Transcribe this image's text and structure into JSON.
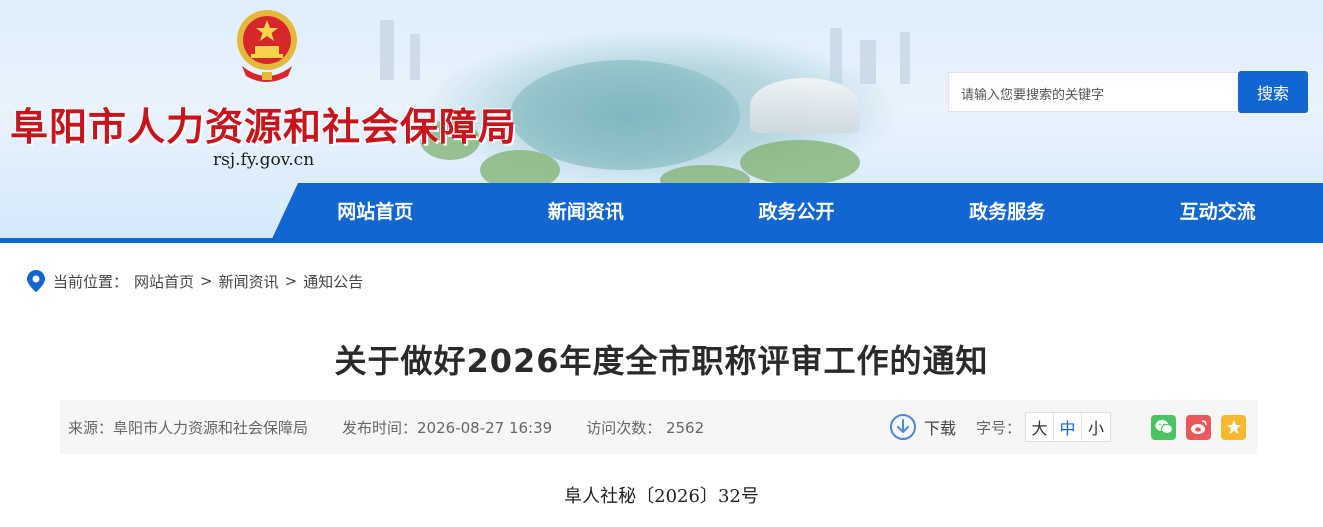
{
  "header": {
    "site_title": "阜阳市人力资源和社会保障局",
    "site_domain": "rsj.fy.gov.cn",
    "search_placeholder": "请输入您要搜索的关键字",
    "search_button": "搜索"
  },
  "nav": {
    "items": [
      {
        "label": "网站首页"
      },
      {
        "label": "新闻资讯"
      },
      {
        "label": "政务公开"
      },
      {
        "label": "政务服务"
      },
      {
        "label": "互动交流"
      }
    ]
  },
  "breadcrumb": {
    "prefix": "当前位置：",
    "items": [
      "网站首页",
      "新闻资讯",
      "通知公告"
    ],
    "separator": ">"
  },
  "article": {
    "title": "关于做好2026年度全市职称评审工作的通知",
    "source_label": "来源：阜阳市人力资源和社会保障局",
    "publish_label": "发布时间：2026-08-27 16:39",
    "visits_label": "访问次数：  2562",
    "download_label": "下载",
    "font_size_label": "字号：",
    "font_sizes": [
      "大",
      "中",
      "小"
    ],
    "doc_number": "阜人社秘〔2026〕32号"
  },
  "icons": {
    "location": "location-pin-icon",
    "download": "download-icon",
    "share_wechat": "wechat-icon",
    "share_weibo": "weibo-icon",
    "share_favorite": "star-icon"
  },
  "colors": {
    "primary": "#1167cf",
    "title_red": "#c8141c",
    "wechat": "#4cc463",
    "weibo": "#e9595b",
    "favorite": "#f6b82f"
  }
}
